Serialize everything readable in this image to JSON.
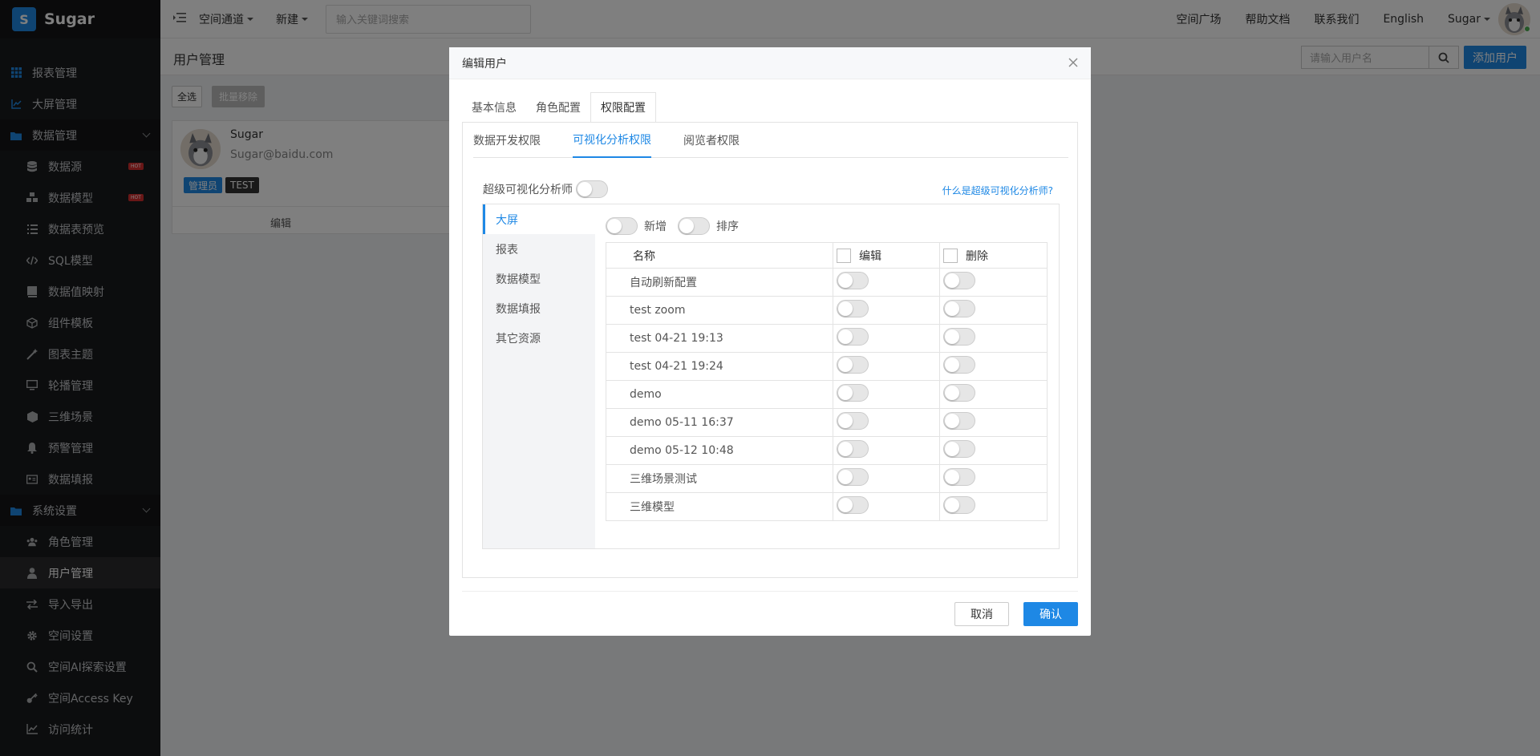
{
  "app": {
    "logo_letter": "S",
    "name": "Sugar"
  },
  "sidebar": {
    "items": [
      {
        "label": "报表管理",
        "icon": "grid-icon",
        "level": "top"
      },
      {
        "label": "大屏管理",
        "icon": "chart-line-icon",
        "level": "top"
      },
      {
        "label": "数据管理",
        "icon": "folder-icon",
        "level": "group"
      },
      {
        "label": "数据源",
        "icon": "database-icon",
        "level": "sub",
        "badge": "HOT"
      },
      {
        "label": "数据模型",
        "icon": "cubes-icon",
        "level": "sub",
        "badge": "HOT"
      },
      {
        "label": "数据表预览",
        "icon": "list-icon",
        "level": "sub"
      },
      {
        "label": "SQL模型",
        "icon": "code-icon",
        "level": "sub"
      },
      {
        "label": "数据值映射",
        "icon": "book-icon",
        "level": "sub"
      },
      {
        "label": "组件模板",
        "icon": "cube-outline-icon",
        "level": "sub"
      },
      {
        "label": "图表主题",
        "icon": "magic-wand-icon",
        "level": "sub"
      },
      {
        "label": "轮播管理",
        "icon": "monitor-icon",
        "level": "sub"
      },
      {
        "label": "三维场景",
        "icon": "box-icon",
        "level": "sub"
      },
      {
        "label": "预警管理",
        "icon": "bell-icon",
        "level": "sub"
      },
      {
        "label": "数据填报",
        "icon": "id-card-icon",
        "level": "sub"
      },
      {
        "label": "系统设置",
        "icon": "folder-icon",
        "level": "group"
      },
      {
        "label": "角色管理",
        "icon": "users-icon",
        "level": "sub"
      },
      {
        "label": "用户管理",
        "icon": "user-icon",
        "level": "sub",
        "active": true
      },
      {
        "label": "导入导出",
        "icon": "exchange-icon",
        "level": "sub"
      },
      {
        "label": "空间设置",
        "icon": "gear-icon",
        "level": "sub"
      },
      {
        "label": "空间AI探索设置",
        "icon": "search-icon",
        "level": "sub"
      },
      {
        "label": "空间Access Key",
        "icon": "key-icon",
        "level": "sub"
      },
      {
        "label": "访问统计",
        "icon": "chart-area-icon",
        "level": "sub"
      }
    ]
  },
  "topbar": {
    "space_channel": "空间通道",
    "new": "新建",
    "search_placeholder": "输入关键词搜索",
    "plaza": "空间广场",
    "help": "帮助文档",
    "contact": "联系我们",
    "language": "English",
    "user": "Sugar"
  },
  "page": {
    "title": "用户管理",
    "user_search_placeholder": "请输入用户名",
    "add_user": "添加用户",
    "select_all": "全选",
    "batch_remove": "批量移除"
  },
  "user_card": {
    "name": "Sugar",
    "email": "Sugar@baidu.com",
    "tags": [
      "管理员",
      "TEST"
    ],
    "edit": "编辑"
  },
  "modal": {
    "title": "编辑用户",
    "tabs": [
      "基本信息",
      "角色配置",
      "权限配置"
    ],
    "active_tab": 2,
    "subtabs": [
      "数据开发权限",
      "可视化分析权限",
      "阅览者权限"
    ],
    "active_subtab": 1,
    "super_analyst_label": "超级可视化分析师",
    "help_link": "什么是超级可视化分析师?",
    "resource_types": [
      "大屏",
      "报表",
      "数据模型",
      "数据填报",
      "其它资源"
    ],
    "active_resource": 0,
    "toggle_add": "新增",
    "toggle_sort": "排序",
    "table": {
      "headers": [
        "名称",
        "编辑",
        "删除"
      ],
      "rows": [
        "自动刷新配置",
        "test zoom",
        "test 04-21 19:13",
        "test 04-21 19:24",
        "demo",
        "demo 05-11 16:37",
        "demo 05-12 10:48",
        "三维场景测试",
        "三维模型"
      ]
    },
    "cancel": "取消",
    "confirm": "确认"
  },
  "colors": {
    "accent": "#1e88e5",
    "sidebar_bg": "#191a1c",
    "hot_badge": "#d32f2f",
    "admin_tag": "#1e88e5",
    "test_tag": "#333333"
  }
}
